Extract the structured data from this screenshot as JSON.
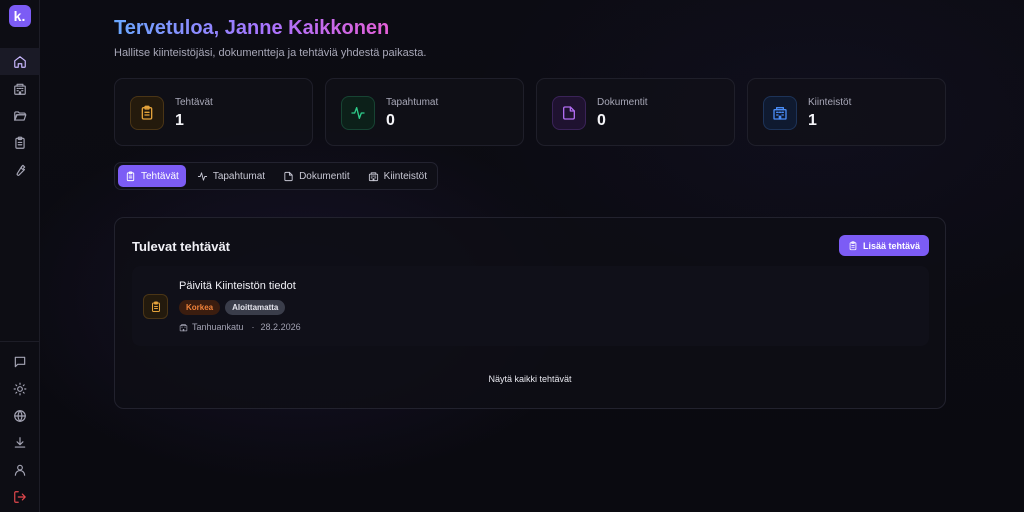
{
  "app": {
    "logo_letter": "k."
  },
  "header": {
    "title": "Tervetuloa, Janne Kaikkonen",
    "subtitle": "Hallitse kiinteistöjäsi, dokumentteja ja tehtäviä yhdestä paikasta."
  },
  "stats": [
    {
      "label": "Tehtävät",
      "value": "1",
      "icon": "clipboard-icon",
      "color": "#e3a23b"
    },
    {
      "label": "Tapahtumat",
      "value": "0",
      "icon": "activity-icon",
      "color": "#2ecc8a"
    },
    {
      "label": "Dokumentit",
      "value": "0",
      "icon": "file-icon",
      "color": "#b06cf0"
    },
    {
      "label": "Kiinteistöt",
      "value": "1",
      "icon": "building-icon",
      "color": "#4a8cf5"
    }
  ],
  "tabs": [
    {
      "label": "Tehtävät",
      "active": true
    },
    {
      "label": "Tapahtumat",
      "active": false
    },
    {
      "label": "Dokumentit",
      "active": false
    },
    {
      "label": "Kiinteistöt",
      "active": false
    }
  ],
  "panel": {
    "title": "Tulevat tehtävät",
    "add_label": "Lisää tehtävä",
    "show_all_label": "Näytä kaikki tehtävät",
    "tasks": [
      {
        "title": "Päivitä Kiinteistön tiedot",
        "priority": "Korkea",
        "status": "Aloittamatta",
        "property": "Tanhuankatu",
        "date": "28.2.2026"
      }
    ]
  },
  "colors": {
    "accent": "#7c5cf5",
    "logout": "#e5484d"
  }
}
